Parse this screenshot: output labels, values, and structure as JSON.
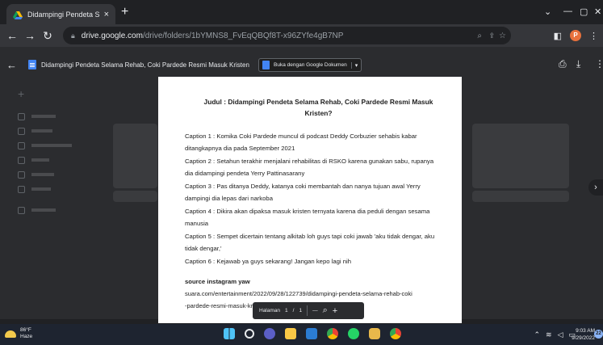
{
  "browser": {
    "tab_title": "Didampingi Pendeta Selama Reh",
    "tab_close": "×",
    "new_tab": "+",
    "url_host": "drive.google.com",
    "url_path": "/drive/folders/1bYMNS8_FvEqQBQf8T-x96ZYfe4gB7NP",
    "profile_initial": "P"
  },
  "viewer": {
    "file_title": "Didampingi Pendeta Selama Rehab, Coki Pardede Resmi Masuk Kristen",
    "open_with": "Buka dengan Google Dokumen"
  },
  "document": {
    "title": "Judul : Didampingi Pendeta Selama Rehab, Coki Pardede Resmi Masuk Kristen?",
    "captions": [
      "Caption 1 : Komika Coki Pardede muncul di podcast Deddy Corbuzier sehabis kabar ditangkapnya dia pada September 2021",
      "Caption 2 : Setahun terakhir menjalani rehabilitas di RSKO karena gunakan sabu, rupanya dia didampingi pendeta Yerry Pattinasarany",
      "Caption 3 : Pas ditanya Deddy, katanya coki membantah dan nanya tujuan awal Yerry dampingi dia lepas dari narkoba",
      "Caption 4 : Dikira akan dipaksa masuk kristen ternyata karena dia peduli dengan sesama manusia",
      "Caption 5 : Sempet dicertain tentang alkitab loh guys tapi coki jawab 'aku tidak dengar, aku tidak dengar,'",
      "Caption 6 : Kejawab ya guys sekarang! Jangan kepo lagi nih"
    ],
    "source_heading": "source instagram yaw",
    "source_url_1": "suara.com/entertainment/2022/09/28/122739/didampingi-pendeta-selama-rehab-coki",
    "source_url_2": "-pardede-resmi-masuk-kristen"
  },
  "pager": {
    "label": "Halaman",
    "current": "1",
    "separator": "/",
    "total": "1",
    "zoom_out": "—",
    "zoom_icon": "search-icon",
    "zoom_in": "+"
  },
  "taskbar": {
    "temperature": "86°F",
    "weather": "Haze",
    "time": "9:03 AM",
    "date": "9/29/2022",
    "notifications": "22"
  },
  "colors": {
    "accent_blue": "#4285f4",
    "page_white": "#ffffff",
    "chrome_dark": "#202124"
  }
}
